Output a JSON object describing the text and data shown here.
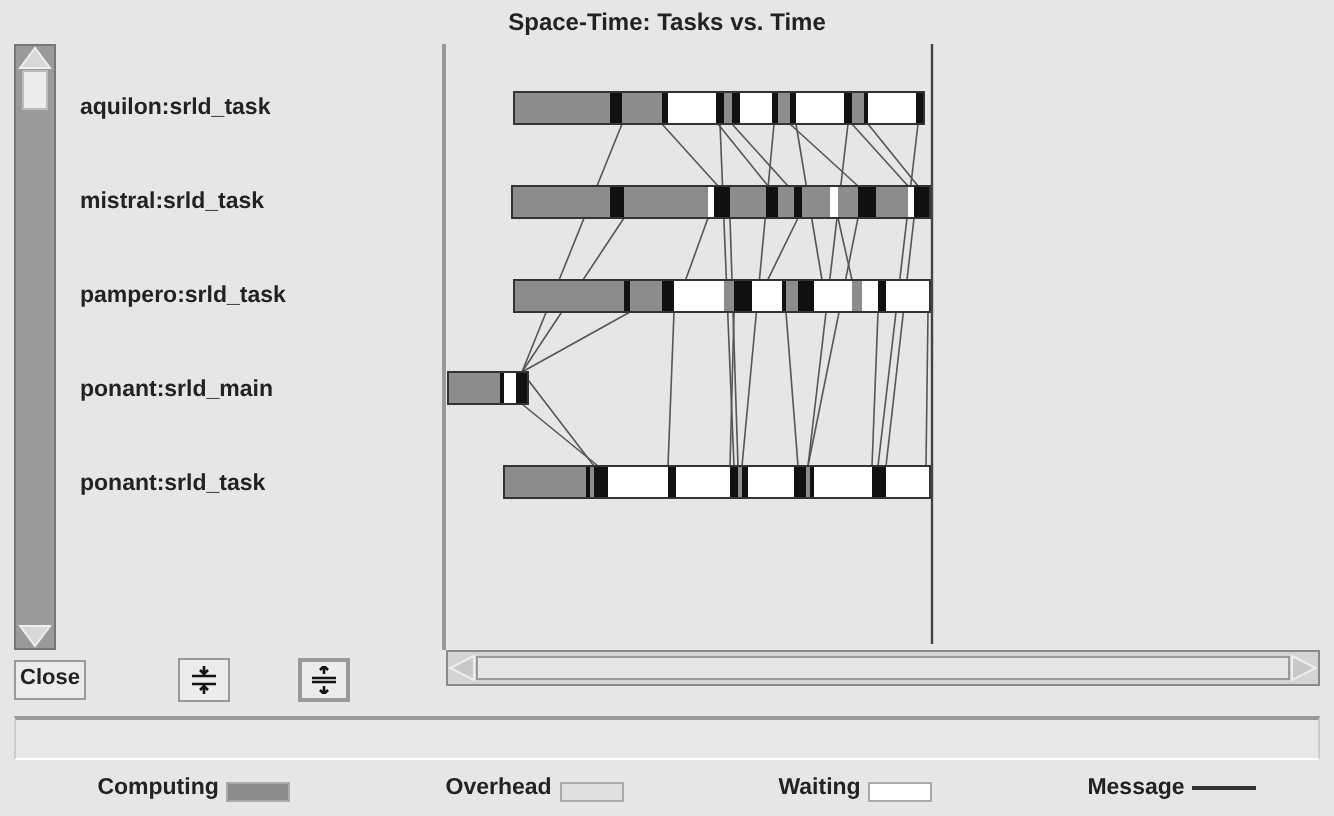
{
  "window": {
    "title": "Space-Time: Tasks vs. Time"
  },
  "tasks": [
    "aquilon:srld_task",
    "mistral:srld_task",
    "pampero:srld_task",
    "ponant:srld_main",
    "ponant:srld_task"
  ],
  "buttons": {
    "close": "Close"
  },
  "legend": [
    {
      "kind": "fill",
      "label": "Computing",
      "color": "#8c8c8c"
    },
    {
      "kind": "fill",
      "label": "Overhead",
      "color": "#e0e0e0"
    },
    {
      "kind": "fill",
      "label": "Waiting",
      "color": "#ffffff"
    },
    {
      "kind": "line",
      "label": "Message",
      "color": "#333333"
    }
  ]
}
